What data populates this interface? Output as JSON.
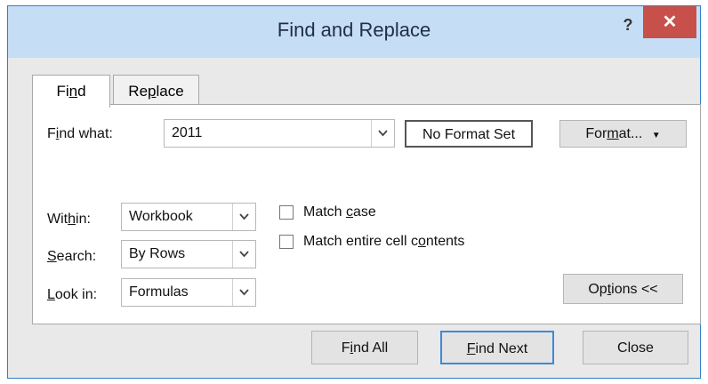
{
  "window": {
    "title": "Find and Replace",
    "help_glyph": "?",
    "close_glyph": "✕"
  },
  "tabs": [
    {
      "label_parts": [
        "Fi",
        "n",
        "d"
      ],
      "active": true
    },
    {
      "label_parts": [
        "Re",
        "p",
        "lace"
      ],
      "active": false
    }
  ],
  "find": {
    "label_parts": [
      "F",
      "i",
      "nd what:"
    ],
    "value": "2011",
    "format_status": "No Format Set",
    "format_button_parts": [
      "For",
      "m",
      "at..."
    ]
  },
  "within": {
    "label_parts": [
      "Wit",
      "h",
      "in:"
    ],
    "value": "Workbook"
  },
  "search": {
    "label_parts": [
      "",
      "S",
      "earch:"
    ],
    "value": "By Rows"
  },
  "look_in": {
    "label_parts": [
      "",
      "L",
      "ook in:"
    ],
    "value": "Formulas"
  },
  "options": {
    "match_case_parts": [
      "Match ",
      "c",
      "ase"
    ],
    "match_case_checked": false,
    "match_entire_parts": [
      "Match entire cell c",
      "o",
      "ntents"
    ],
    "match_entire_checked": false
  },
  "options_button_parts": [
    "Op",
    "t",
    "ions <<"
  ],
  "footer": {
    "find_all_parts": [
      "F",
      "i",
      "nd All"
    ],
    "find_next_parts": [
      "",
      "F",
      "ind Next"
    ],
    "close_label": "Close"
  },
  "icons": {
    "dropdown_arrow": "chevron-down-icon",
    "close": "close-icon",
    "help": "help-icon"
  }
}
